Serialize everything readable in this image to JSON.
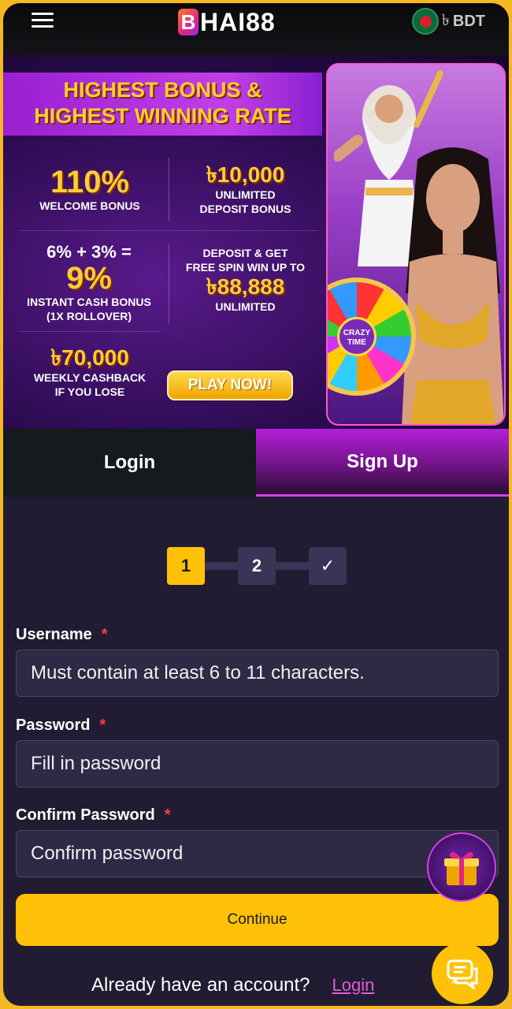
{
  "header": {
    "logo_letter": "B",
    "logo_text": "HAI88",
    "currency_symbol": "৳",
    "currency_code": "BDT"
  },
  "banner": {
    "headline_line1": "HIGHEST BONUS &",
    "headline_line2": "HIGHEST WINNING RATE",
    "promo1_value": "110%",
    "promo1_label": "WELCOME BONUS",
    "promo2_value": "৳10,000",
    "promo2_label1": "UNLIMITED",
    "promo2_label2": "DEPOSIT BONUS",
    "promo3_formula": "6% + 3% =",
    "promo3_value": "9%",
    "promo3_label1": "INSTANT CASH BONUS",
    "promo3_label2": "(1X ROLLOVER)",
    "promo4_label1": "DEPOSIT & GET",
    "promo4_label2": "FREE SPIN WIN UP TO",
    "promo4_value": "৳88,888",
    "promo4_label3": "UNLIMITED",
    "promo5_value": "৳70,000",
    "promo5_label1": "WEEKLY CASHBACK",
    "promo5_label2": "IF YOU LOSE",
    "play_button": "PLAY NOW!",
    "wheel_label": "CRAZY TIME"
  },
  "tabs": {
    "login": "Login",
    "signup": "Sign Up",
    "active": "signup"
  },
  "steps": {
    "step1": "1",
    "step2": "2",
    "step3": "✓",
    "current": 1
  },
  "form": {
    "username_label": "Username",
    "username_placeholder": "Must contain at least 6 to 11 characters.",
    "password_label": "Password",
    "password_placeholder": "Fill in password",
    "confirm_label": "Confirm Password",
    "confirm_placeholder": "Confirm password",
    "required_mark": "*",
    "continue_label": "Continue"
  },
  "footer": {
    "account_text": "Already have an account?",
    "login_link": "Login"
  },
  "colors": {
    "accent": "#ffc107",
    "brand_purple": "#b41fd9",
    "page_bg": "#211c31",
    "link": "#e25bd9"
  }
}
